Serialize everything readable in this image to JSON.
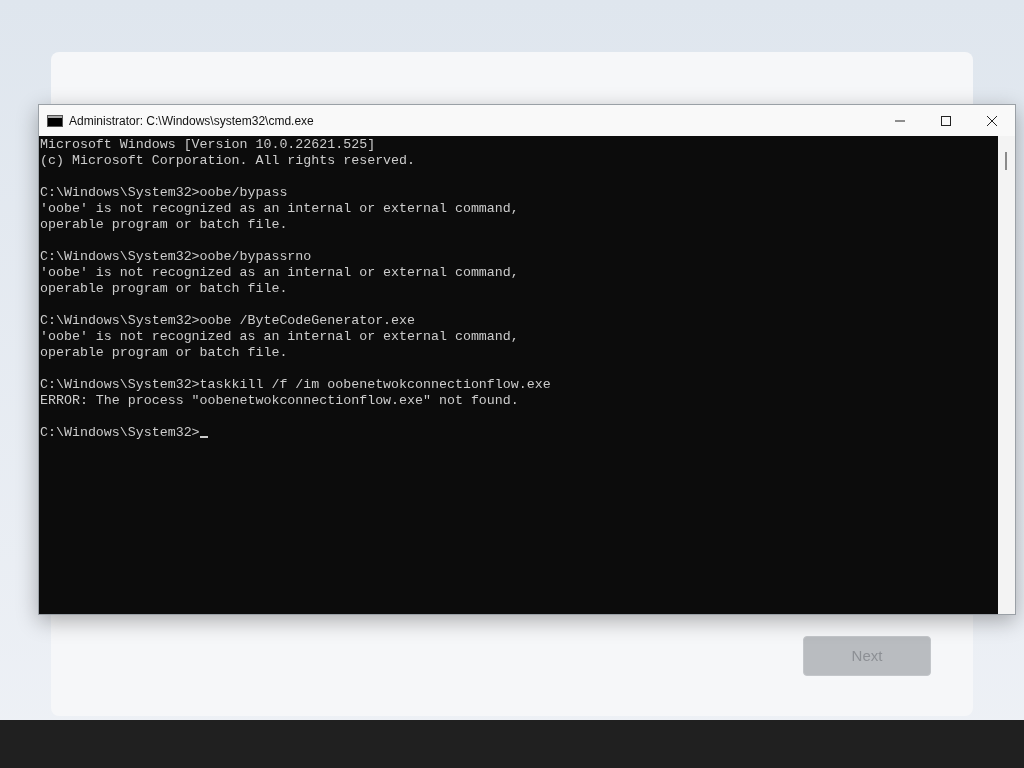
{
  "setup_page": {
    "next_button": {
      "label": "Next",
      "disabled": true
    }
  },
  "console_window": {
    "title": "Administrator: C:\\Windows\\system32\\cmd.exe",
    "blocks": [
      [
        "Microsoft Windows [Version 10.0.22621.525]",
        "(c) Microsoft Corporation. All rights reserved."
      ],
      [
        "C:\\Windows\\System32>oobe/bypass",
        "'oobe' is not recognized as an internal or external command,",
        "operable program or batch file."
      ],
      [
        "C:\\Windows\\System32>oobe/bypassrno",
        "'oobe' is not recognized as an internal or external command,",
        "operable program or batch file."
      ],
      [
        "C:\\Windows\\System32>oobe /ByteCodeGenerator.exe",
        "'oobe' is not recognized as an internal or external command,",
        "operable program or batch file."
      ],
      [
        "C:\\Windows\\System32>taskkill /f /im oobenetwokconnectionflow.exe",
        "ERROR: The process \"oobenetwokconnectionflow.exe\" not found."
      ]
    ],
    "prompt": "C:\\Windows\\System32>"
  }
}
